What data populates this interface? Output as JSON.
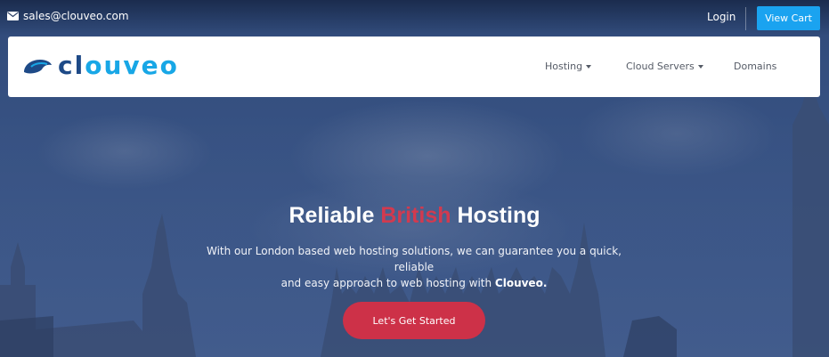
{
  "topbar": {
    "email": "sales@clouveo.com",
    "login_label": "Login",
    "cart_label": "View Cart"
  },
  "logo": {
    "text_part1": "cl",
    "text_part2": "ouveo"
  },
  "nav": {
    "items": [
      {
        "label": "Hosting"
      },
      {
        "label": "Cloud Servers"
      },
      {
        "label": "Domains"
      }
    ]
  },
  "hero": {
    "headline_part1": "Reliable ",
    "headline_accent": "British",
    "headline_part2": " Hosting",
    "subtext_line1": "With our London based web hosting solutions, we can guarantee you a quick, reliable",
    "subtext_line2_prefix": "and easy approach to web hosting with ",
    "subtext_brand": "Clouveo.",
    "cta_label": "Let's Get Started"
  },
  "colors": {
    "accent_blue": "#1aa3f0",
    "accent_red": "#cd3148",
    "brand_dark": "#1e4a87"
  }
}
